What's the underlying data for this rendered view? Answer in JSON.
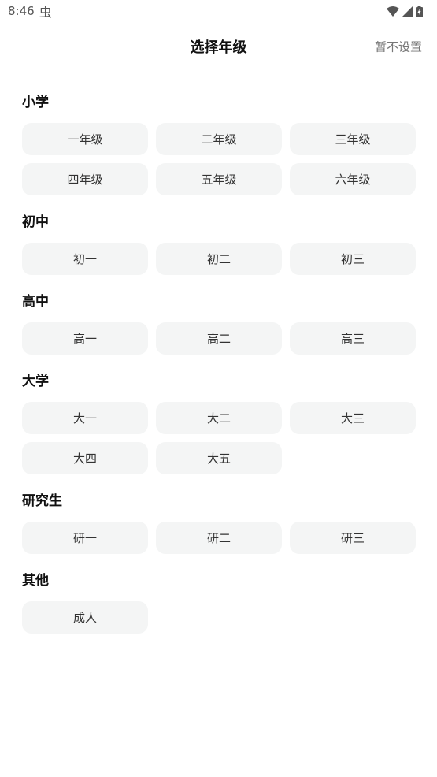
{
  "status": {
    "time": "8:46",
    "notif_icon": "bug-icon",
    "icons": [
      "wifi-icon",
      "signal-icon",
      "battery-charging-icon"
    ]
  },
  "header": {
    "title": "选择年级",
    "skip_label": "暂不设置"
  },
  "sections": [
    {
      "title": "小学",
      "items": [
        "一年级",
        "二年级",
        "三年级",
        "四年级",
        "五年级",
        "六年级"
      ]
    },
    {
      "title": "初中",
      "items": [
        "初一",
        "初二",
        "初三"
      ]
    },
    {
      "title": "高中",
      "items": [
        "高一",
        "高二",
        "高三"
      ]
    },
    {
      "title": "大学",
      "items": [
        "大一",
        "大二",
        "大三",
        "大四",
        "大五"
      ]
    },
    {
      "title": "研究生",
      "items": [
        "研一",
        "研二",
        "研三"
      ]
    },
    {
      "title": "其他",
      "items": [
        "成人"
      ]
    }
  ]
}
